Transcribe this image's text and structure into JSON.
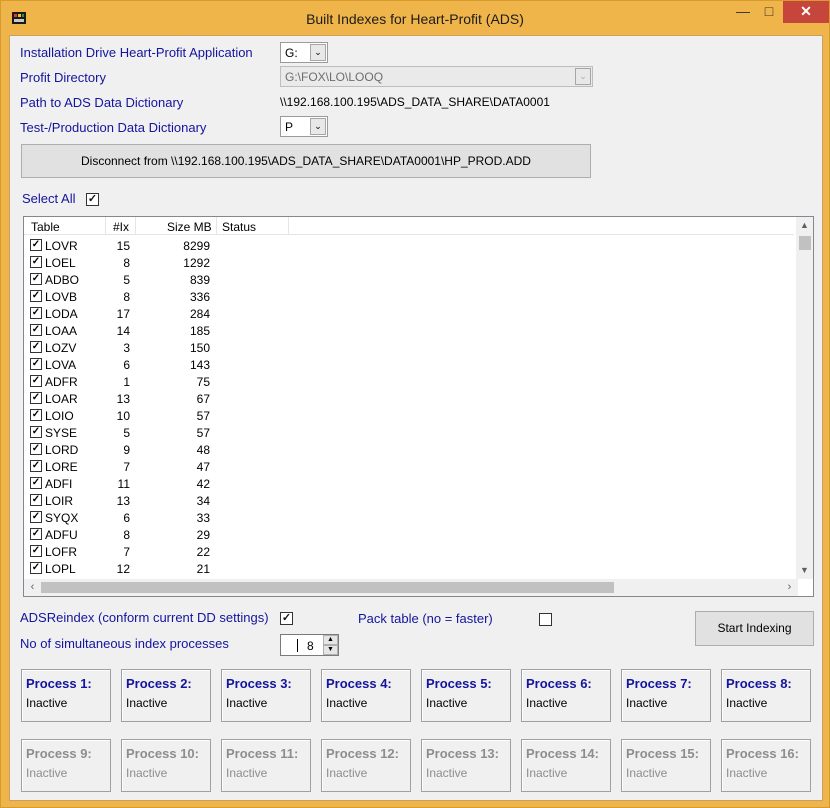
{
  "window": {
    "title": "Built Indexes for Heart-Profit (ADS)",
    "controls": {
      "minimize": "—",
      "maximize": "□",
      "close": "✕"
    }
  },
  "form": {
    "install_drive_label": "Installation Drive Heart-Profit Application",
    "install_drive_value": "G:",
    "profit_dir_label": "Profit Directory",
    "profit_dir_value": "G:\\FOX\\LO\\LOOQ",
    "path_label": "Path to ADS Data Dictionary",
    "path_value": "\\\\192.168.100.195\\ADS_DATA_SHARE\\DATA0001",
    "test_prod_label": "Test-/Production Data Dictionary",
    "test_prod_value": "P",
    "disconnect_button": "Disconnect from \\\\192.168.100.195\\ADS_DATA_SHARE\\DATA0001\\HP_PROD.ADD",
    "select_all_label": "Select All"
  },
  "table": {
    "columns": [
      "Table",
      "#Ix",
      "Size MB",
      "Status"
    ],
    "rows": [
      {
        "name": "LOVR",
        "ix": "15",
        "size": "8299",
        "status": ""
      },
      {
        "name": "LOEL",
        "ix": "8",
        "size": "1292",
        "status": ""
      },
      {
        "name": "ADBO",
        "ix": "5",
        "size": "839",
        "status": ""
      },
      {
        "name": "LOVB",
        "ix": "8",
        "size": "336",
        "status": ""
      },
      {
        "name": "LODA",
        "ix": "17",
        "size": "284",
        "status": ""
      },
      {
        "name": "LOAA",
        "ix": "14",
        "size": "185",
        "status": ""
      },
      {
        "name": "LOZV",
        "ix": "3",
        "size": "150",
        "status": ""
      },
      {
        "name": "LOVA",
        "ix": "6",
        "size": "143",
        "status": ""
      },
      {
        "name": "ADFR",
        "ix": "1",
        "size": "75",
        "status": ""
      },
      {
        "name": "LOAR",
        "ix": "13",
        "size": "67",
        "status": ""
      },
      {
        "name": "LOIO",
        "ix": "10",
        "size": "57",
        "status": ""
      },
      {
        "name": "SYSE",
        "ix": "5",
        "size": "57",
        "status": ""
      },
      {
        "name": "LORD",
        "ix": "9",
        "size": "48",
        "status": ""
      },
      {
        "name": "LORE",
        "ix": "7",
        "size": "47",
        "status": ""
      },
      {
        "name": "ADFI",
        "ix": "11",
        "size": "42",
        "status": ""
      },
      {
        "name": "LOIR",
        "ix": "13",
        "size": "34",
        "status": ""
      },
      {
        "name": "SYQX",
        "ix": "6",
        "size": "33",
        "status": ""
      },
      {
        "name": "ADFU",
        "ix": "8",
        "size": "29",
        "status": ""
      },
      {
        "name": "LOFR",
        "ix": "7",
        "size": "22",
        "status": ""
      },
      {
        "name": "LOPL",
        "ix": "12",
        "size": "21",
        "status": ""
      }
    ]
  },
  "options": {
    "adsreindex_label": "ADSReindex (conform current DD settings)",
    "pack_label": "Pack table (no = faster)",
    "simultaneous_label": "No of simultaneous index processes",
    "simultaneous_value": "8",
    "start_button": "Start Indexing"
  },
  "processes": [
    {
      "name": "Process 1:",
      "status": "Inactive"
    },
    {
      "name": "Process 2:",
      "status": "Inactive"
    },
    {
      "name": "Process 3:",
      "status": "Inactive"
    },
    {
      "name": "Process 4:",
      "status": "Inactive"
    },
    {
      "name": "Process 5:",
      "status": "Inactive"
    },
    {
      "name": "Process 6:",
      "status": "Inactive"
    },
    {
      "name": "Process 7:",
      "status": "Inactive"
    },
    {
      "name": "Process 8:",
      "status": "Inactive"
    },
    {
      "name": "Process 9:",
      "status": "Inactive"
    },
    {
      "name": "Process 10:",
      "status": "Inactive"
    },
    {
      "name": "Process 11:",
      "status": "Inactive"
    },
    {
      "name": "Process 12:",
      "status": "Inactive"
    },
    {
      "name": "Process 13:",
      "status": "Inactive"
    },
    {
      "name": "Process 14:",
      "status": "Inactive"
    },
    {
      "name": "Process 15:",
      "status": "Inactive"
    },
    {
      "name": "Process 16:",
      "status": "Inactive"
    }
  ],
  "icons": {
    "check": "✓",
    "dropdown": "⌄",
    "scroll_up": "▲",
    "scroll_down": "▼",
    "scroll_left": "‹",
    "scroll_right": "›"
  },
  "colors": {
    "title_bar": "#f0b54a",
    "label_blue": "#14149e",
    "close_button": "#c7463c"
  }
}
